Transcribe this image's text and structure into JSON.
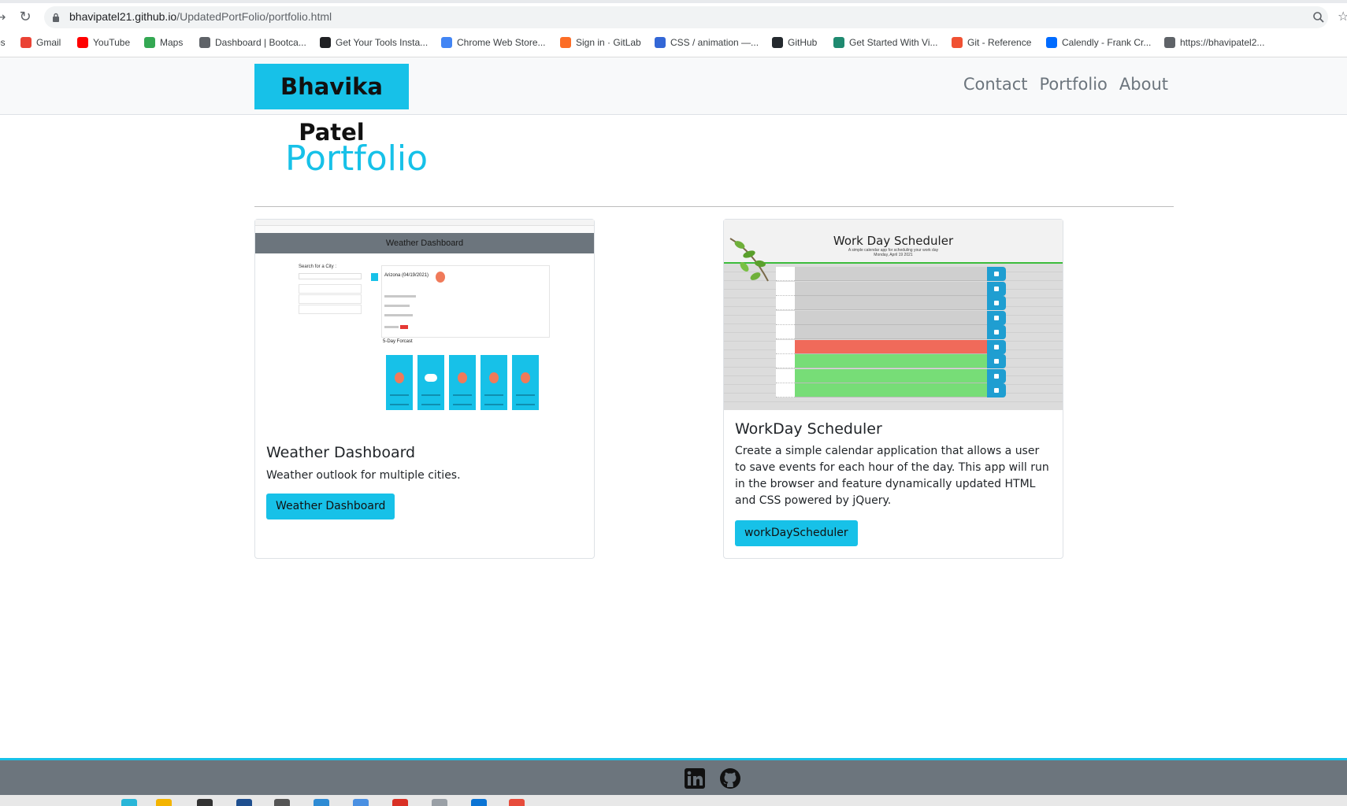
{
  "browser": {
    "url_host": "bhavipatel21.github.io",
    "url_path": "/UpdatedPortFolio/portfolio.html",
    "bookmarks": [
      {
        "label": "ps",
        "color": "#777777"
      },
      {
        "label": "Gmail",
        "color": "#ea4335"
      },
      {
        "label": "YouTube",
        "color": "#ff0000"
      },
      {
        "label": "Maps",
        "color": "#34a853"
      },
      {
        "label": "Dashboard | Bootca...",
        "color": "#5f6368"
      },
      {
        "label": "Get Your Tools Insta...",
        "color": "#202124"
      },
      {
        "label": "Chrome Web Store...",
        "color": "#4285f4"
      },
      {
        "label": "Sign in · GitLab",
        "color": "#fc6d26"
      },
      {
        "label": "CSS / animation —...",
        "color": "#3367d6"
      },
      {
        "label": "GitHub",
        "color": "#24292e"
      },
      {
        "label": "Get Started With Vi...",
        "color": "#1f8a70"
      },
      {
        "label": "Git - Reference",
        "color": "#f05133"
      },
      {
        "label": "Calendly - Frank Cr...",
        "color": "#006bff"
      },
      {
        "label": "https://bhavipatel2...",
        "color": "#5f6368"
      }
    ]
  },
  "nav": {
    "brand": "Bhavika Patel",
    "links": [
      "Contact",
      "Portfolio",
      "About"
    ]
  },
  "page": {
    "title": "Portfolio"
  },
  "projects": [
    {
      "title": "Weather Dashboard",
      "description": "Weather outlook for multiple cities.",
      "button": "Weather Dashboard",
      "thumb": {
        "header": "Weather Dashboard",
        "search_label": "Search for a City :",
        "city": "Arizona (04/19/2021)",
        "forecast_label": "5-Day Forcast"
      }
    },
    {
      "title": "WorkDay Scheduler",
      "description": "Create a simple calendar application that allows a user to save events for each hour of the day. This app will run in the browser and feature dynamically updated HTML and CSS powered by jQuery.",
      "button": "workDayScheduler",
      "thumb": {
        "header": "Work Day Scheduler",
        "subtitle": "A simple calendar app for scheduling your work day",
        "date": "Monday, April 19 2021"
      }
    }
  ],
  "footer": {
    "icons": [
      "linkedin-icon",
      "github-icon"
    ]
  },
  "colors": {
    "accent": "#17c1e8",
    "footer": "#6c757d",
    "nav_bg": "#f8f9fa"
  }
}
